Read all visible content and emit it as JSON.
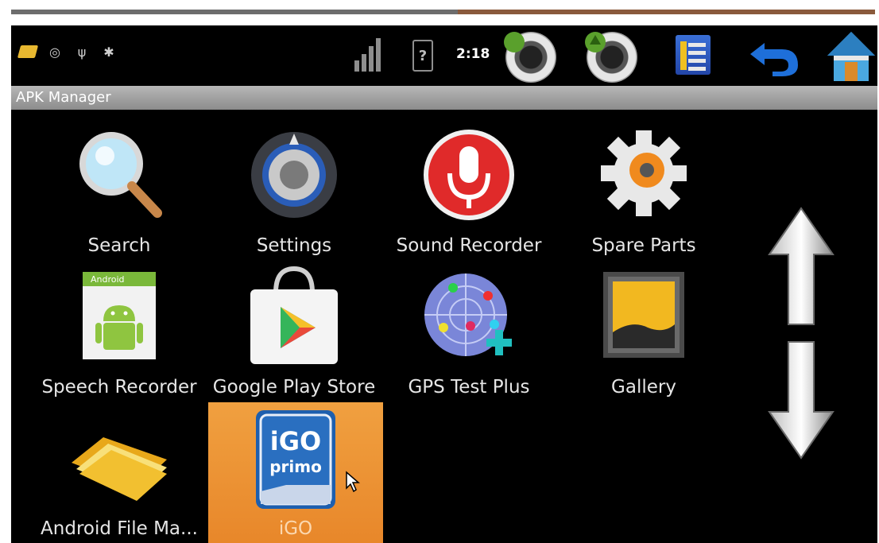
{
  "status_bar": {
    "time": "2:18",
    "battery_glyph": "?"
  },
  "title_bar": {
    "title": "APK Manager"
  },
  "apps": [
    {
      "label": "Search",
      "icon": "magnifier-icon"
    },
    {
      "label": "Settings",
      "icon": "settings-knob-icon"
    },
    {
      "label": "Sound Recorder",
      "icon": "microphone-icon"
    },
    {
      "label": "Spare Parts",
      "icon": "gear-icon"
    },
    {
      "label": "Speech Recorder",
      "icon": "android-icon"
    },
    {
      "label": "Google Play Store",
      "icon": "play-store-bag-icon"
    },
    {
      "label": "GPS Test Plus",
      "icon": "radar-icon"
    },
    {
      "label": "Gallery",
      "icon": "gallery-icon"
    },
    {
      "label": "Android File Ma...",
      "icon": "folder-icon"
    },
    {
      "label": "iGO",
      "icon": "igo-primo-icon",
      "selected": true
    }
  ],
  "igo_icon_text": {
    "line1": "iGO",
    "line2": "primo"
  },
  "speech_badge": "Android",
  "colors": {
    "selected_bg": "#e8872a",
    "title_bar": "#9e9e9e",
    "screen_bg": "#000000"
  }
}
